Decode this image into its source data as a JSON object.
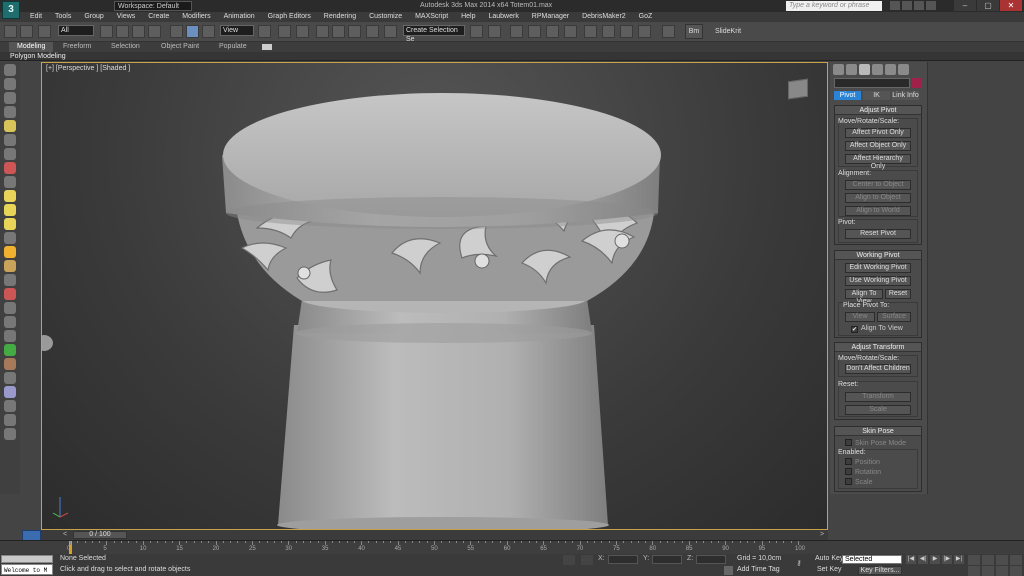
{
  "titlebar": {
    "app_icon_glyph": "3",
    "workspace": "Workspace: Default",
    "title": "Autodesk 3ds Max 2014 x64     Totem01.max",
    "search_placeholder": "Type a keyword or phrase",
    "window_buttons": [
      "–",
      "▢",
      "✕"
    ]
  },
  "menu": {
    "items": [
      "Edit",
      "Tools",
      "Group",
      "Views",
      "Create",
      "Modifiers",
      "Animation",
      "Graph Editors",
      "Rendering",
      "Customize",
      "MAXScript",
      "Help",
      "Laubwerk",
      "RPManager",
      "DebrisMaker2",
      "GoZ"
    ]
  },
  "toolbar": {
    "filter": "All",
    "ref_coord": "View",
    "named_selection": "Create Selection Se",
    "bm_label": "Bm",
    "slidekrit_label": "SlideKrit"
  },
  "ribbon": {
    "tabs": [
      "Modeling",
      "Freeform",
      "Selection",
      "Object Paint",
      "Populate"
    ],
    "active_tab": "Modeling",
    "sub_label": "Polygon Modeling"
  },
  "viewport": {
    "label": "[+] [Perspective ] [Shaded ]"
  },
  "command_panel": {
    "hier_tabs": [
      "Pivot",
      "IK",
      "Link Info"
    ],
    "active_tab": "Pivot",
    "swatch_color": "#a0224a",
    "adjust_pivot": {
      "title": "Adjust Pivot",
      "move_label": "Move/Rotate/Scale:",
      "affect_pivot": "Affect Pivot Only",
      "affect_object": "Affect Object Only",
      "affect_hierarchy": "Affect Hierarchy Only",
      "alignment_label": "Alignment:",
      "center_to_object": "Center to Object",
      "align_to_object": "Align to Object",
      "align_to_world": "Align to World",
      "pivot_label": "Pivot:",
      "reset_pivot": "Reset Pivot"
    },
    "working_pivot": {
      "title": "Working Pivot",
      "edit": "Edit Working Pivot",
      "use": "Use Working Pivot",
      "align_to_view": "Align To View",
      "reset": "Reset",
      "place_label": "Place Pivot To:",
      "view": "View",
      "surface": "Surface",
      "align_to_view_check": "Align To View",
      "check_mark": "✔"
    },
    "adjust_transform": {
      "title": "Adjust Transform",
      "move_label": "Move/Rotate/Scale:",
      "dont_affect": "Don't Affect Children",
      "reset_label": "Reset:",
      "transform": "Transform",
      "scale": "Scale"
    },
    "skin_pose": {
      "title": "Skin Pose",
      "mode": "Skin Pose Mode",
      "enabled_label": "Enabled:",
      "position": "Position",
      "rotation": "Rotation",
      "scale": "Scale"
    }
  },
  "timeline": {
    "slider": "0 / 100",
    "prev": "<",
    "next": ">",
    "ticks": [
      "0",
      "5",
      "10",
      "15",
      "20",
      "25",
      "30",
      "35",
      "40",
      "45",
      "50",
      "55",
      "60",
      "65",
      "70",
      "75",
      "80",
      "85",
      "90",
      "95",
      "100"
    ]
  },
  "status": {
    "listener": "Welcome to M",
    "selected": "None Selected",
    "prompt": "Click and drag to select and rotate objects",
    "coord_x": "X:",
    "coord_y": "Y:",
    "coord_z": "Z:",
    "grid": "Grid = 10,0cm",
    "add_time_tag": "Add Time Tag",
    "auto_key": "Auto Key",
    "set_key": "Set Key",
    "selection_mode": "Selected",
    "key_filters": "Key Filters...",
    "play_controls": [
      "|◀",
      "◀|",
      "▶",
      "|▶",
      "▶|"
    ]
  }
}
